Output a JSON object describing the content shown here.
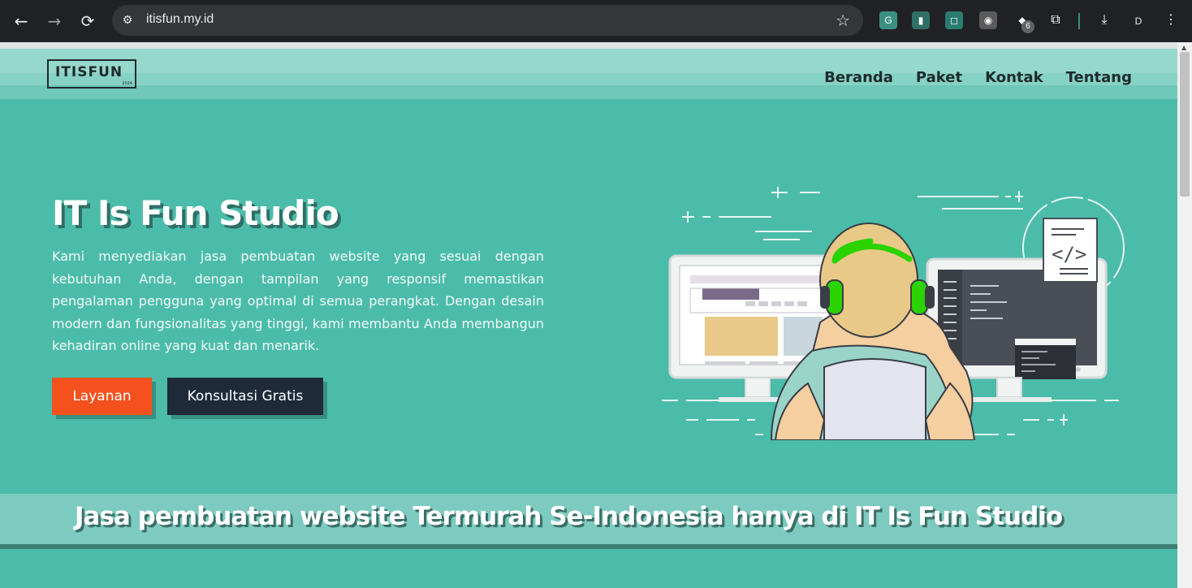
{
  "browser": {
    "url": "itisfun.my.id",
    "extension_badge": "6",
    "profile_initial": "D"
  },
  "site": {
    "logo_text": "ITISFUN",
    "logo_year": "2024",
    "menu": [
      {
        "label": "Beranda"
      },
      {
        "label": "Paket"
      },
      {
        "label": "Kontak"
      },
      {
        "label": "Tentang"
      }
    ]
  },
  "hero": {
    "title": "IT Is Fun Studio",
    "description": "Kami menyediakan jasa pembuatan website yang sesuai dengan kebutuhan Anda, dengan tampilan yang responsif memastikan pengalaman pengguna yang optimal di semua perangkat. Dengan desain modern dan fungsionalitas yang tinggi, kami membantu Anda membangun kehadiran online yang kuat dan menarik.",
    "primary_button": "Layanan",
    "secondary_button": "Konsultasi Gratis",
    "code_sign": "</>"
  },
  "banner": {
    "text": "Jasa pembuatan website Termurah Se-Indonesia hanya di IT Is Fun Studio"
  },
  "colors": {
    "page_bg": "#4bbca9",
    "primary_button": "#f4511e",
    "secondary_button": "#1e2a3a"
  }
}
